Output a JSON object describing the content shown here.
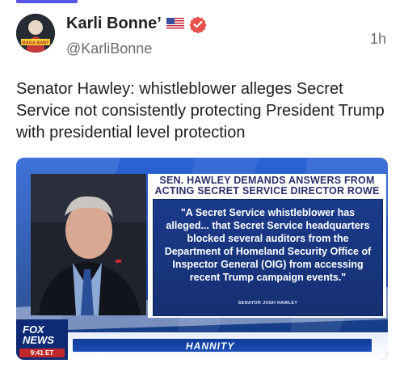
{
  "post": {
    "author_name": "Karli Bonne’",
    "handle": "@KarliBonne",
    "timestamp": "1h",
    "text": "Senator Hawley: whistleblower alleges Secret Service not consistently protecting President Trump with presidential level protection",
    "avatar_text": "MAGA BABY"
  },
  "media": {
    "headline": "SEN. HAWLEY DEMANDS ANSWERS FROM ACTING SECRET SERVICE DIRECTOR ROWE",
    "quote": "\"A Secret Service whistleblower has alleged... that Secret Service headquarters blocked several auditors from the Department of Homeland Security Office of Inspector General (OIG) from accessing recent Trump campaign events.\"",
    "attribution": "SENATOR JOSH HAWLEY",
    "show_name": "HANNITY",
    "network": "FOX NEWS",
    "time": "9:41 ET"
  }
}
